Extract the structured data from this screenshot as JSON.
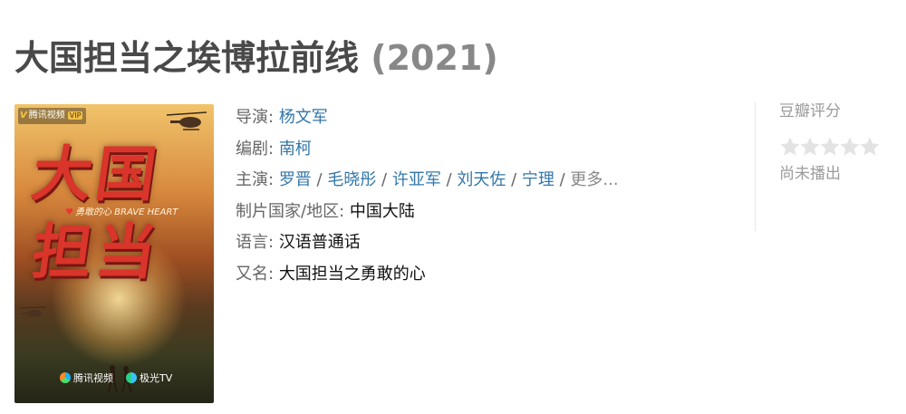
{
  "title": {
    "name": "大国担当之埃博拉前线",
    "year": "(2021)"
  },
  "poster": {
    "badge_brand": "腾讯视频",
    "badge_vip": "VIP",
    "title_line1": "大国",
    "title_line2": "担当",
    "subtitle": "勇敢的心 BRAVE HEART",
    "logo1": "腾讯视频",
    "logo2": "极光TV"
  },
  "info": {
    "director_label": "导演:",
    "director": "杨文军",
    "writer_label": "编剧:",
    "writer": "南柯",
    "cast_label": "主演:",
    "cast": [
      "罗晋",
      "毛晓彤",
      "许亚军",
      "刘天佐",
      "宁理"
    ],
    "cast_more": "更多...",
    "country_label": "制片国家/地区:",
    "country": "中国大陆",
    "language_label": "语言:",
    "language": "汉语普通话",
    "aka_label": "又名:",
    "aka": "大国担当之勇敢的心"
  },
  "rating": {
    "label": "豆瓣评分",
    "stars_filled": 0,
    "stars_total": 5,
    "status": "尚未播出",
    "star_color": "#e3e3e3"
  }
}
